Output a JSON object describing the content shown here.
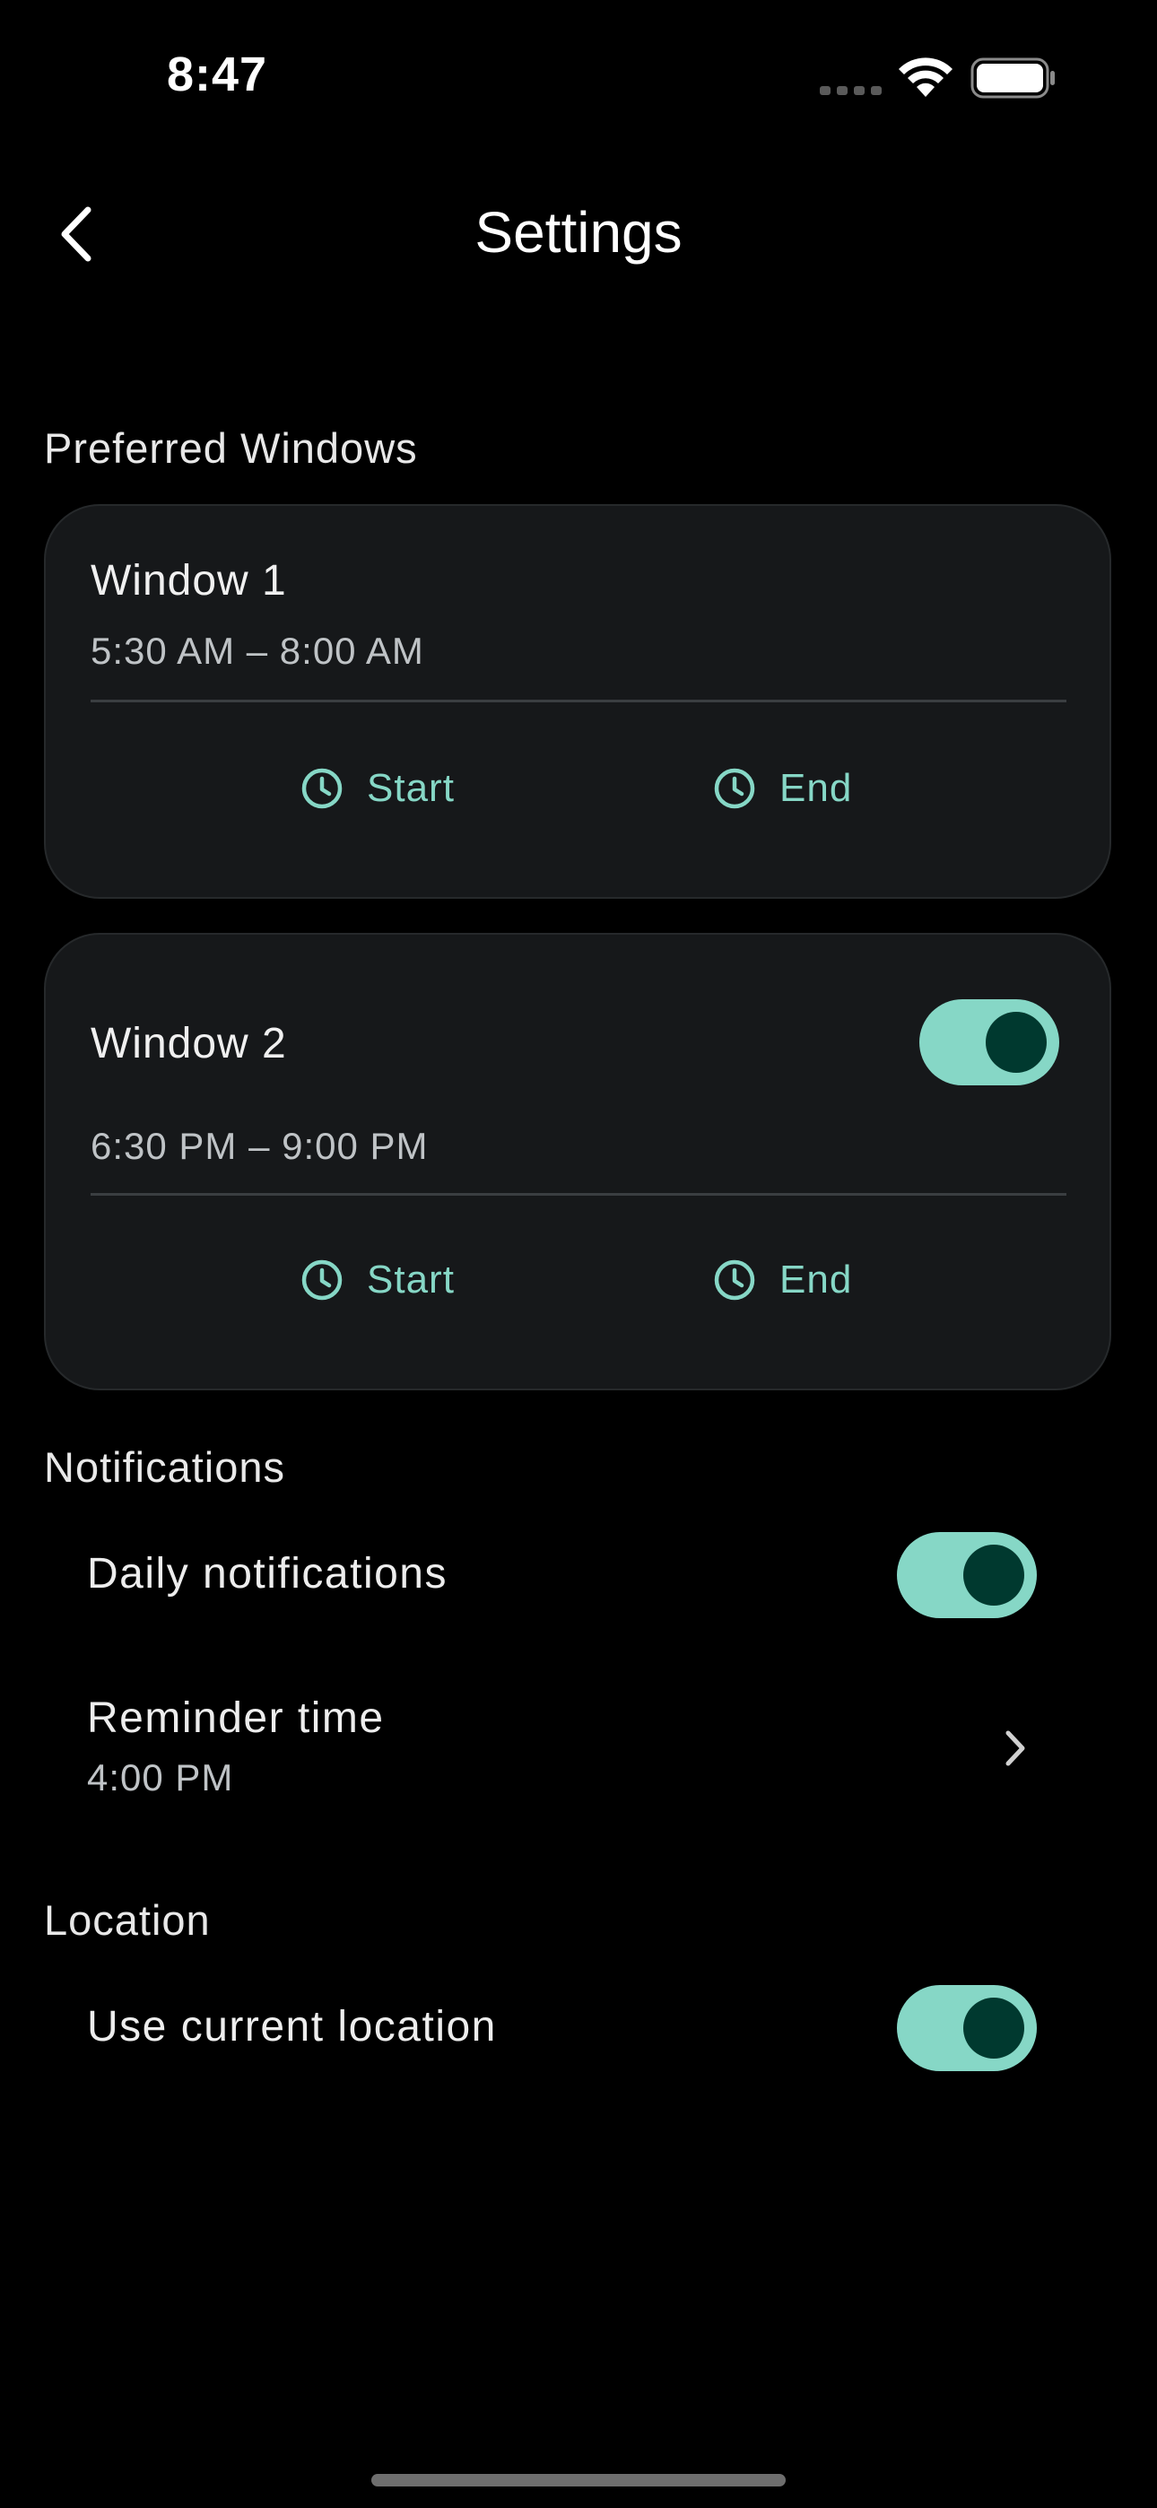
{
  "status_bar": {
    "time": "8:47"
  },
  "nav": {
    "title": "Settings"
  },
  "preferred_windows": {
    "header": "Preferred Windows",
    "windows": [
      {
        "title": "Window 1",
        "range": "5:30 AM – 8:00 AM",
        "start_label": "Start",
        "end_label": "End",
        "has_toggle": false
      },
      {
        "title": "Window 2",
        "range": "6:30 PM – 9:00 PM",
        "start_label": "Start",
        "end_label": "End",
        "has_toggle": true,
        "enabled": true
      }
    ]
  },
  "notifications": {
    "header": "Notifications",
    "daily": {
      "label": "Daily notifications",
      "enabled": true
    },
    "reminder": {
      "label": "Reminder time",
      "value": "4:00 PM"
    }
  },
  "location": {
    "header": "Location",
    "use_current": {
      "label": "Use current location",
      "enabled": true
    }
  },
  "colors": {
    "background": "#000000",
    "card": "#16181A",
    "accent": "#86D7C6",
    "toggle_knob": "#00392F",
    "secondary_text": "#BFC3C6"
  },
  "icons": {
    "back": "chevron-left-icon",
    "start": "clock-icon",
    "end": "clock-icon",
    "reminder": "chevron-right-icon"
  }
}
